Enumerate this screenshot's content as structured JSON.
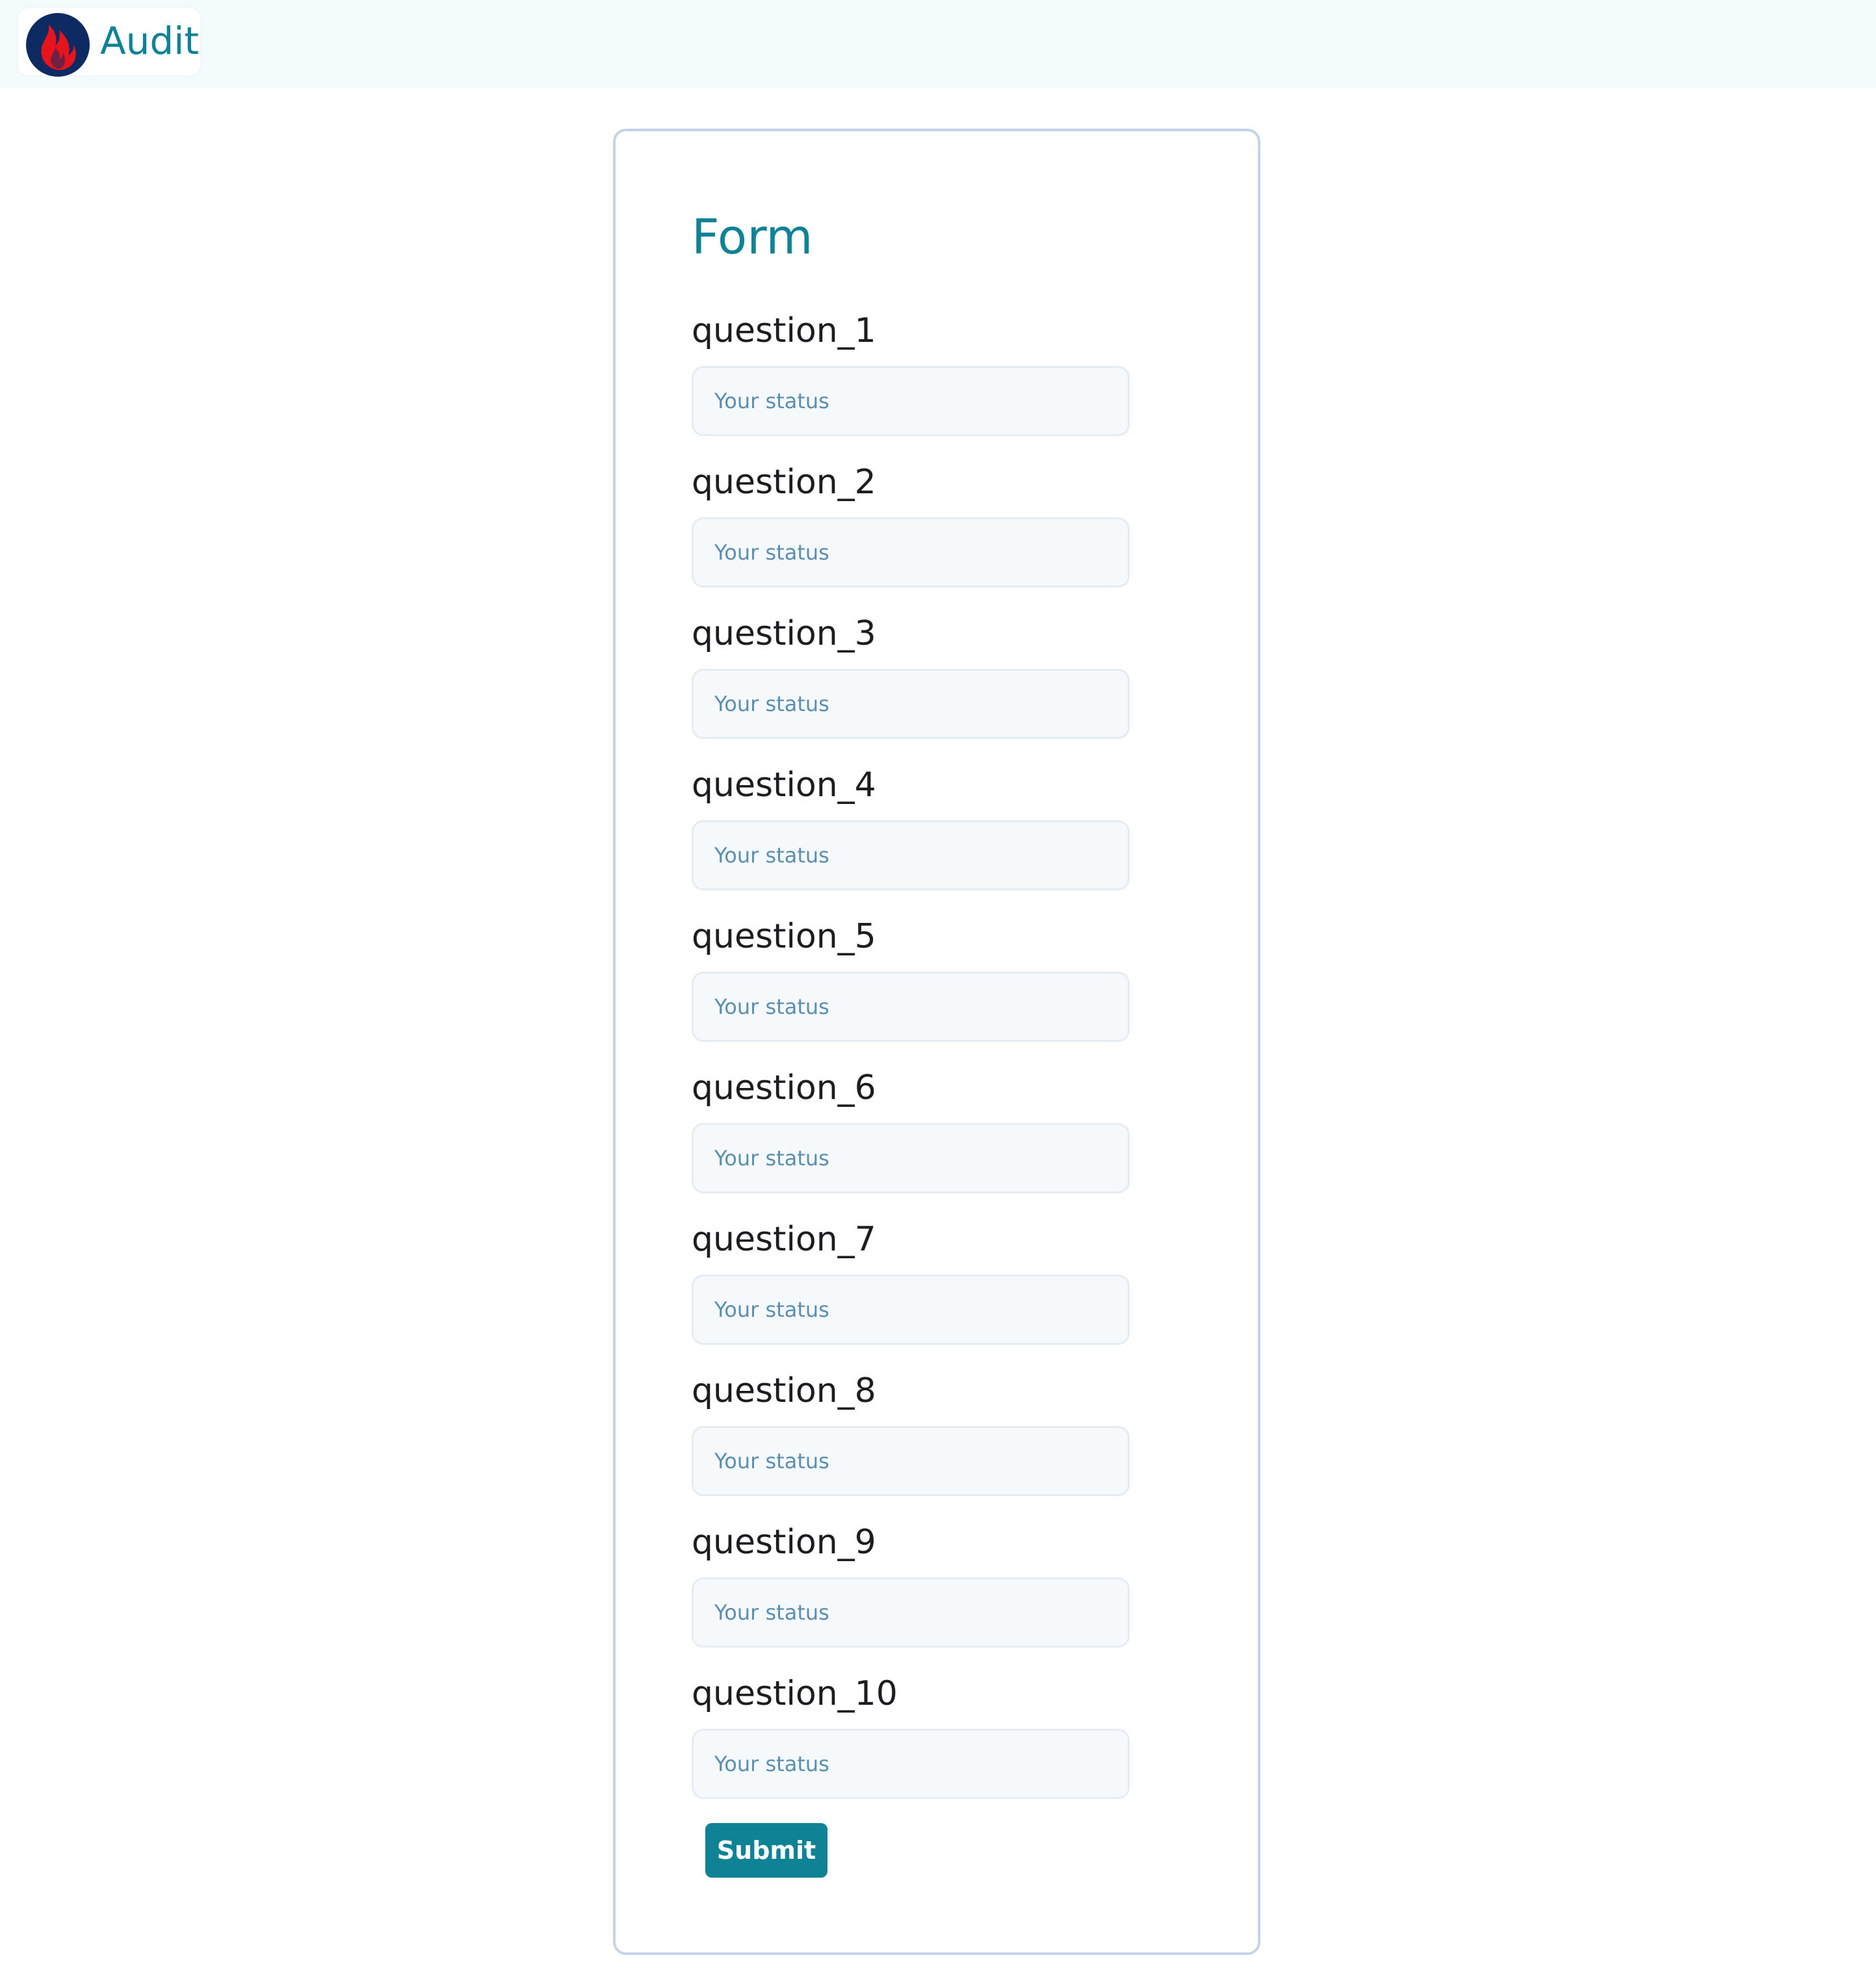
{
  "header": {
    "brand_name": "Audit",
    "logo_icon": "flame-icon"
  },
  "colors": {
    "accent": "#0f8296",
    "header_bg": "#f3fbfc",
    "logo_bg": "#0d2a63",
    "logo_flame": "#e8141d"
  },
  "form": {
    "title": "Form",
    "questions": [
      {
        "label": "question_1",
        "placeholder": "Your status"
      },
      {
        "label": "question_2",
        "placeholder": "Your status"
      },
      {
        "label": "question_3",
        "placeholder": "Your status"
      },
      {
        "label": "question_4",
        "placeholder": "Your status"
      },
      {
        "label": "question_5",
        "placeholder": "Your status"
      },
      {
        "label": "question_6",
        "placeholder": "Your status"
      },
      {
        "label": "question_7",
        "placeholder": "Your status"
      },
      {
        "label": "question_8",
        "placeholder": "Your status"
      },
      {
        "label": "question_9",
        "placeholder": "Your status"
      },
      {
        "label": "question_10",
        "placeholder": "Your status"
      }
    ],
    "submit_label": "Submit"
  }
}
